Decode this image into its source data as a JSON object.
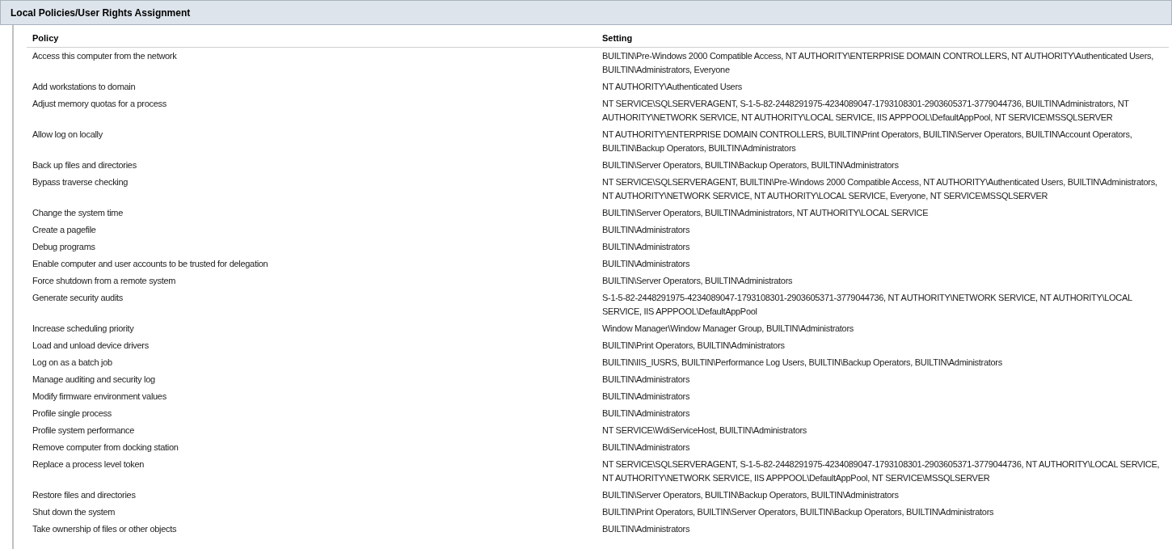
{
  "section": {
    "title": "Local Policies/User Rights Assignment"
  },
  "table": {
    "columns": [
      "Policy",
      "Setting"
    ],
    "rows": [
      {
        "policy": "Access this computer from the network",
        "setting": "BUILTIN\\Pre-Windows 2000 Compatible Access, NT AUTHORITY\\ENTERPRISE DOMAIN CONTROLLERS, NT AUTHORITY\\Authenticated Users, BUILTIN\\Administrators, Everyone"
      },
      {
        "policy": "Add workstations to domain",
        "setting": "NT AUTHORITY\\Authenticated Users"
      },
      {
        "policy": "Adjust memory quotas for a process",
        "setting": "NT SERVICE\\SQLSERVERAGENT, S-1-5-82-2448291975-4234089047-1793108301-2903605371-3779044736, BUILTIN\\Administrators, NT AUTHORITY\\NETWORK SERVICE, NT AUTHORITY\\LOCAL SERVICE, IIS APPPOOL\\DefaultAppPool, NT SERVICE\\MSSQLSERVER"
      },
      {
        "policy": "Allow log on locally",
        "setting": "NT AUTHORITY\\ENTERPRISE DOMAIN CONTROLLERS, BUILTIN\\Print Operators, BUILTIN\\Server Operators, BUILTIN\\Account Operators, BUILTIN\\Backup Operators, BUILTIN\\Administrators"
      },
      {
        "policy": "Back up files and directories",
        "setting": "BUILTIN\\Server Operators, BUILTIN\\Backup Operators, BUILTIN\\Administrators"
      },
      {
        "policy": "Bypass traverse checking",
        "setting": "NT SERVICE\\SQLSERVERAGENT, BUILTIN\\Pre-Windows 2000 Compatible Access, NT AUTHORITY\\Authenticated Users, BUILTIN\\Administrators, NT AUTHORITY\\NETWORK SERVICE, NT AUTHORITY\\LOCAL SERVICE, Everyone, NT SERVICE\\MSSQLSERVER"
      },
      {
        "policy": "Change the system time",
        "setting": "BUILTIN\\Server Operators, BUILTIN\\Administrators, NT AUTHORITY\\LOCAL SERVICE"
      },
      {
        "policy": "Create a pagefile",
        "setting": "BUILTIN\\Administrators"
      },
      {
        "policy": "Debug programs",
        "setting": "BUILTIN\\Administrators"
      },
      {
        "policy": "Enable computer and user accounts to be trusted for delegation",
        "setting": "BUILTIN\\Administrators"
      },
      {
        "policy": "Force shutdown from a remote system",
        "setting": "BUILTIN\\Server Operators, BUILTIN\\Administrators"
      },
      {
        "policy": "Generate security audits",
        "setting": "S-1-5-82-2448291975-4234089047-1793108301-2903605371-3779044736, NT AUTHORITY\\NETWORK SERVICE, NT AUTHORITY\\LOCAL SERVICE, IIS APPPOOL\\DefaultAppPool"
      },
      {
        "policy": "Increase scheduling priority",
        "setting": "Window Manager\\Window Manager Group, BUILTIN\\Administrators"
      },
      {
        "policy": "Load and unload device drivers",
        "setting": "BUILTIN\\Print Operators, BUILTIN\\Administrators"
      },
      {
        "policy": "Log on as a batch job",
        "setting": "BUILTIN\\IIS_IUSRS, BUILTIN\\Performance Log Users, BUILTIN\\Backup Operators, BUILTIN\\Administrators"
      },
      {
        "policy": "Manage auditing and security log",
        "setting": "BUILTIN\\Administrators"
      },
      {
        "policy": "Modify firmware environment values",
        "setting": "BUILTIN\\Administrators"
      },
      {
        "policy": "Profile single process",
        "setting": "BUILTIN\\Administrators"
      },
      {
        "policy": "Profile system performance",
        "setting": "NT SERVICE\\WdiServiceHost, BUILTIN\\Administrators"
      },
      {
        "policy": "Remove computer from docking station",
        "setting": "BUILTIN\\Administrators"
      },
      {
        "policy": "Replace a process level token",
        "setting": "NT SERVICE\\SQLSERVERAGENT, S-1-5-82-2448291975-4234089047-1793108301-2903605371-3779044736, NT AUTHORITY\\LOCAL SERVICE, NT AUTHORITY\\NETWORK SERVICE, IIS APPPOOL\\DefaultAppPool, NT SERVICE\\MSSQLSERVER"
      },
      {
        "policy": "Restore files and directories",
        "setting": "BUILTIN\\Server Operators, BUILTIN\\Backup Operators, BUILTIN\\Administrators"
      },
      {
        "policy": "Shut down the system",
        "setting": "BUILTIN\\Print Operators, BUILTIN\\Server Operators, BUILTIN\\Backup Operators, BUILTIN\\Administrators"
      },
      {
        "policy": "Take ownership of files or other objects",
        "setting": "BUILTIN\\Administrators"
      }
    ]
  }
}
